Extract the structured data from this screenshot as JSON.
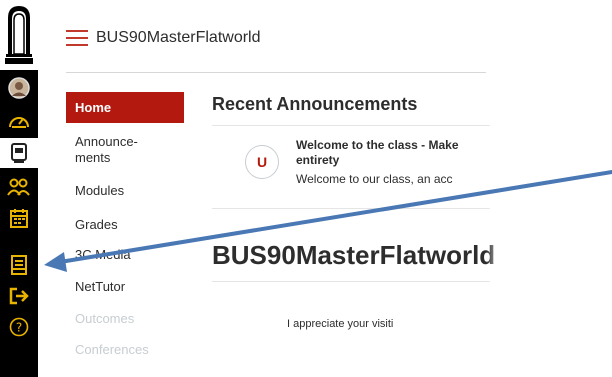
{
  "header": {
    "course_title": "BUS90MasterFlatworld"
  },
  "course_nav": {
    "items": [
      {
        "label": "Home",
        "state": "active"
      },
      {
        "label": "Announce-",
        "label2": "ments",
        "state": "normal"
      },
      {
        "label": "Modules",
        "state": "normal"
      },
      {
        "label": "Grades",
        "state": "normal"
      },
      {
        "label": "3C Media",
        "state": "normal"
      },
      {
        "label": "NetTutor",
        "state": "normal"
      },
      {
        "label": "Outcomes",
        "state": "muted"
      },
      {
        "label": "Conferences",
        "state": "muted"
      }
    ]
  },
  "main": {
    "recent_title": "Recent Announcements",
    "announcement": {
      "avatar_letter": "U",
      "title_line1": "Welcome to the class - Make",
      "title_line2": "entirety",
      "preview": "Welcome to our class, an acc"
    },
    "page_title": "BUS90MasterFlatworld",
    "body_text": "I appreciate your visiti"
  },
  "global_nav": {
    "icons": [
      "university-logo-icon",
      "profile-avatar-icon",
      "dashboard-icon",
      "courses-icon",
      "groups-icon",
      "calendar-icon",
      "inbox-icon",
      "logout-icon",
      "help-icon"
    ]
  },
  "colors": {
    "accent": "#b3190e",
    "nav_bg": "#000000",
    "nav_icon": "#e8b400",
    "arrow": "#4a78b5"
  }
}
